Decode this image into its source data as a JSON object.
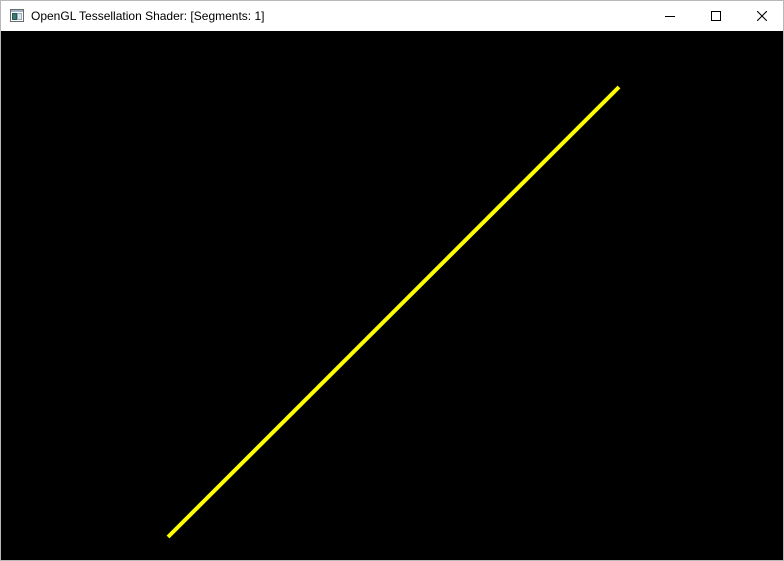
{
  "window": {
    "title": "OpenGL Tessellation Shader: [Segments: 1]",
    "icon": "opengl-window-icon",
    "controls": {
      "minimize_icon": "minimize-icon",
      "maximize_icon": "maximize-icon",
      "close_icon": "close-icon"
    }
  },
  "viewport": {
    "background": "#000000",
    "segments": 1,
    "line_color": "#ffff00"
  }
}
